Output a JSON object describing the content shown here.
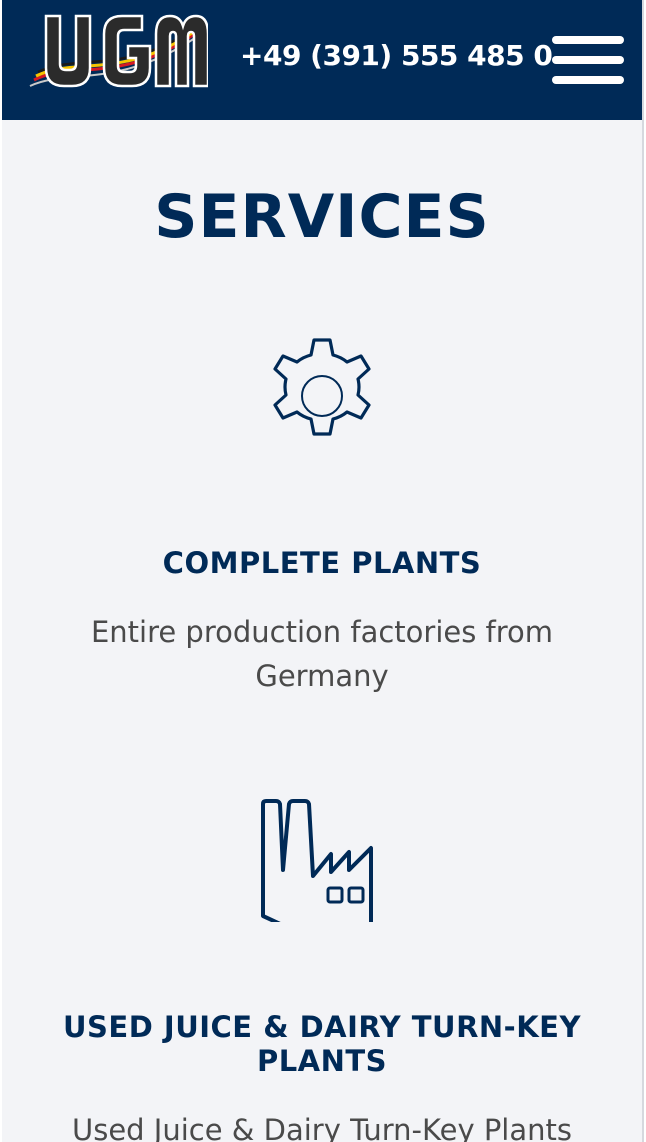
{
  "header": {
    "logo_text": "UGM",
    "phone": "+49 (391) 555 485 0",
    "menu_icon": "hamburger-menu-icon"
  },
  "section": {
    "title": "SERVICES"
  },
  "services": [
    {
      "icon": "gear-icon",
      "title": "COMPLETE PLANTS",
      "description": "Entire production factories from Germany"
    },
    {
      "icon": "factory-icon",
      "title": "USED JUICE & DAIRY TURN-KEY PLANTS",
      "description": "Used Juice & Dairy Turn-Key Plants"
    }
  ],
  "colors": {
    "navy": "#002a57",
    "background": "#f3f4f7",
    "text": "#4a4a4a"
  }
}
